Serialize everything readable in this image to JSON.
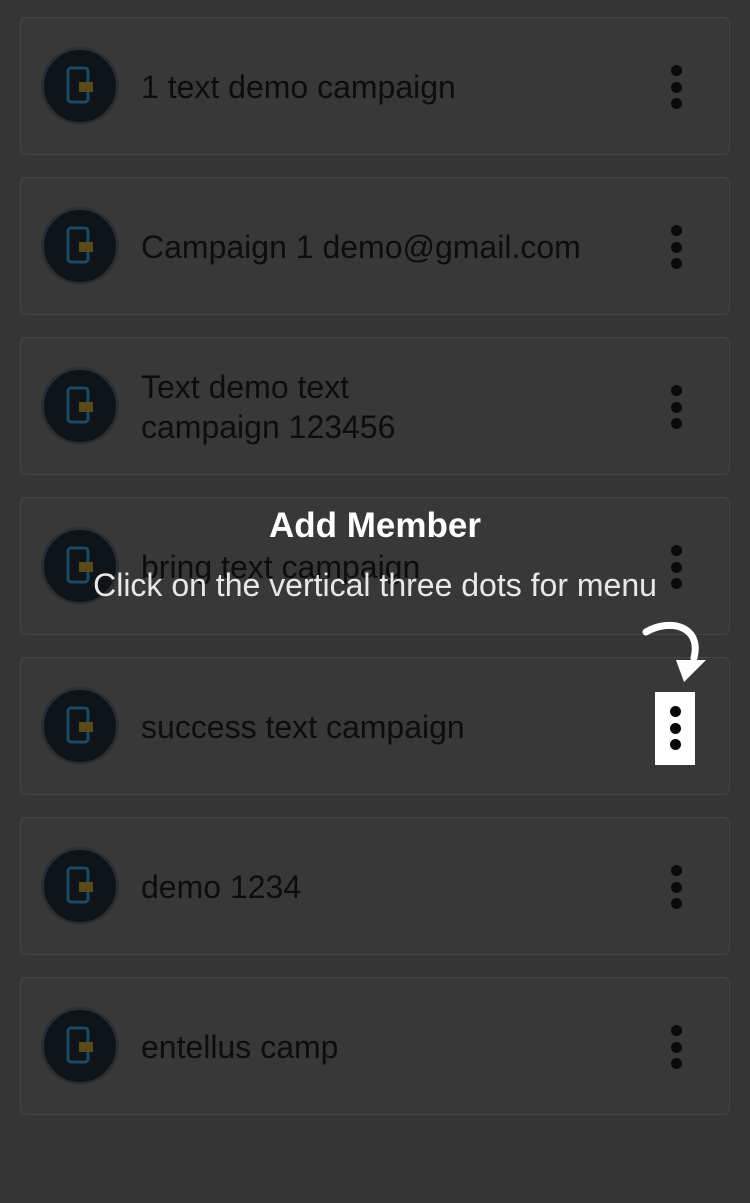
{
  "campaigns": [
    {
      "title": "1 text demo campaign"
    },
    {
      "title": "Campaign 1 demo@gmail.com"
    },
    {
      "title": "Text demo text\ncampaign 123456"
    },
    {
      "title": "bring text campaign"
    },
    {
      "title": "success text campaign"
    },
    {
      "title": "demo 1234"
    },
    {
      "title": "entellus camp"
    }
  ],
  "coachmark": {
    "title": "Add Member",
    "instruction": "Click on the vertical three dots for menu"
  },
  "colors": {
    "overlay": "#353535",
    "card_border": "#454545",
    "highlight": "#ffffff"
  }
}
